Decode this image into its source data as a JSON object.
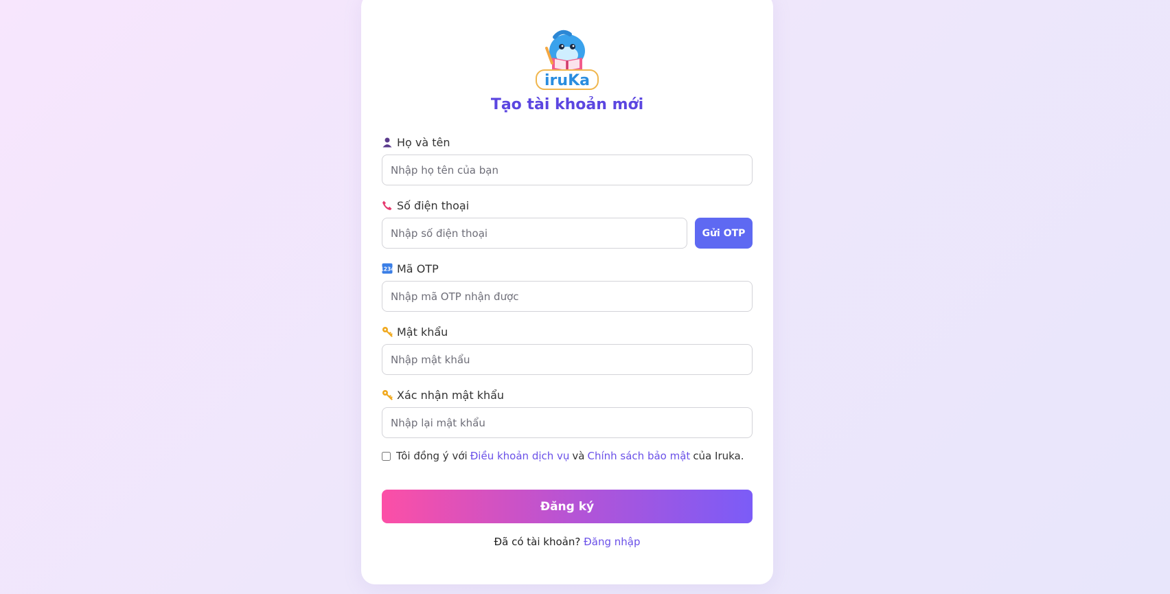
{
  "logo": {
    "text": "iruKa",
    "icon": "dolphin-mascot-logo"
  },
  "form": {
    "title": "Tạo tài khoản mới",
    "fullname": {
      "label": "Họ và tên",
      "placeholder": "Nhập họ tên của bạn",
      "value": "",
      "icon": "person-icon"
    },
    "phone": {
      "label": "Số điện thoại",
      "placeholder": "Nhập số điện thoại",
      "value": "",
      "icon": "phone-icon",
      "otp_button": "Gửi OTP"
    },
    "otp": {
      "label": "Mã OTP",
      "placeholder": "Nhập mã OTP nhận được",
      "value": "",
      "icon": "numbers-icon"
    },
    "password": {
      "label": "Mật khẩu",
      "placeholder": "Nhập mật khẩu",
      "value": "",
      "icon": "key-icon"
    },
    "confirm_password": {
      "label": "Xác nhận mật khẩu",
      "placeholder": "Nhập lại mật khẩu",
      "value": "",
      "icon": "key-icon"
    },
    "terms": {
      "checked": false,
      "prefix": "Tôi đồng ý với",
      "terms_link": "Điều khoản dịch vụ",
      "and": "và",
      "privacy_link": "Chính sách bảo mật",
      "suffix": "của Iruka."
    },
    "submit_label": "Đăng ký",
    "login_prompt": "Đã có tài khoản?",
    "login_link": "Đăng nhập"
  },
  "colors": {
    "accent": "#5b46e0",
    "otp_button": "#5e69f2",
    "link": "#6a50e8",
    "submit_gradient_start": "#fc4fa6",
    "submit_gradient_end": "#7b5cf7"
  }
}
